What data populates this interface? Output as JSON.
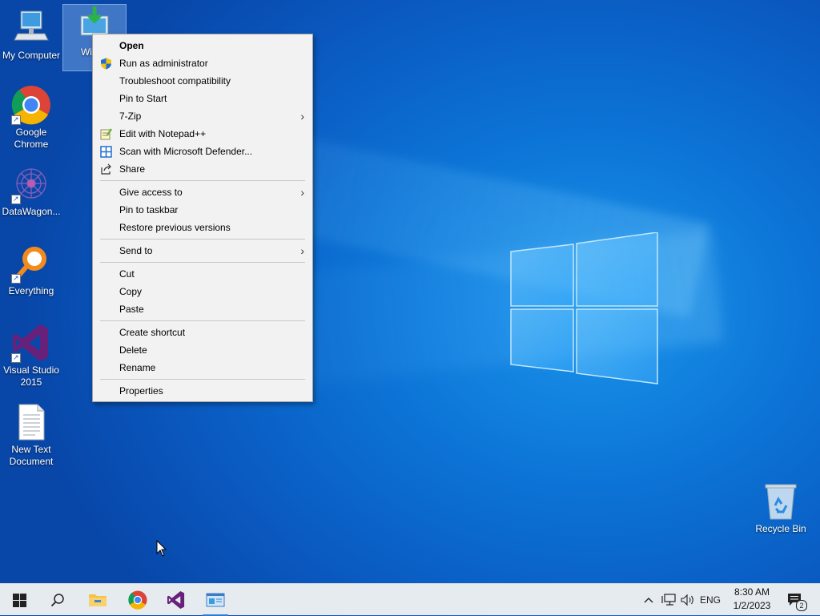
{
  "desktop": {
    "icons": [
      {
        "label": "My Computer",
        "icon": "computer-icon"
      },
      {
        "label": "Windo",
        "icon": "windows-update-icon",
        "selected": true
      },
      {
        "label": "Google Chrome",
        "icon": "chrome-icon",
        "shortcut": true
      },
      {
        "label": "DataWagon...",
        "icon": "datawagon-icon",
        "shortcut": true
      },
      {
        "label": "Everything",
        "icon": "everything-search-icon",
        "shortcut": true
      },
      {
        "label": "Visual Studio 2015",
        "icon": "visual-studio-icon",
        "shortcut": true
      },
      {
        "label": "New Text Document",
        "icon": "text-document-icon"
      },
      {
        "label": "Recycle Bin",
        "icon": "recycle-bin-icon"
      }
    ]
  },
  "context_menu": {
    "group1": [
      {
        "label": "Open",
        "bold": true
      },
      {
        "label": "Run as administrator",
        "icon": "shield-icon"
      },
      {
        "label": "Troubleshoot compatibility"
      },
      {
        "label": "Pin to Start"
      },
      {
        "label": "7-Zip",
        "submenu": true
      },
      {
        "label": "Edit with Notepad++",
        "icon": "notepad-plus-icon"
      },
      {
        "label": "Scan with Microsoft Defender...",
        "icon": "defender-icon"
      },
      {
        "label": "Share",
        "icon": "share-icon"
      }
    ],
    "group2": [
      {
        "label": "Give access to",
        "submenu": true
      },
      {
        "label": "Pin to taskbar"
      },
      {
        "label": "Restore previous versions"
      }
    ],
    "group3": [
      {
        "label": "Send to",
        "submenu": true
      }
    ],
    "group4": [
      {
        "label": "Cut"
      },
      {
        "label": "Copy"
      },
      {
        "label": "Paste"
      }
    ],
    "group5": [
      {
        "label": "Create shortcut"
      },
      {
        "label": "Delete"
      },
      {
        "label": "Rename"
      }
    ],
    "group6": [
      {
        "label": "Properties"
      }
    ],
    "submenu_arrow": "›"
  },
  "taskbar": {
    "apps": [
      {
        "icon": "start-windows-icon"
      },
      {
        "icon": "search-icon"
      },
      {
        "icon": "file-explorer-icon"
      },
      {
        "icon": "chrome-icon"
      },
      {
        "icon": "visual-studio-icon"
      },
      {
        "icon": "app-window-icon",
        "active": true
      }
    ],
    "tray": {
      "language": "ENG",
      "time": "8:30 AM",
      "date": "1/2/2023",
      "notification_count": "2",
      "icons": [
        "chevron-up-icon",
        "network-icon",
        "volume-icon",
        "action-center-icon"
      ]
    }
  },
  "colors": {
    "taskbar_bg": "#e6ebf0",
    "menu_bg": "#f2f2f2",
    "accent": "#2b7cd3"
  }
}
